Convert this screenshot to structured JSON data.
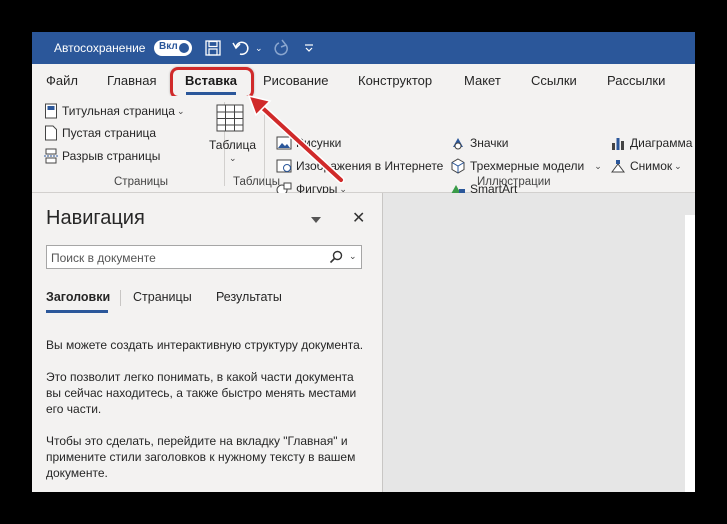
{
  "titlebar": {
    "autosave_label": "Автосохранение",
    "autosave_state": "Вкл"
  },
  "tabs": [
    {
      "label": "Файл"
    },
    {
      "label": "Главная"
    },
    {
      "label": "Вставка",
      "active": true
    },
    {
      "label": "Рисование"
    },
    {
      "label": "Конструктор"
    },
    {
      "label": "Макет"
    },
    {
      "label": "Ссылки"
    },
    {
      "label": "Рассылки"
    }
  ],
  "ribbon": {
    "pages": {
      "items": [
        "Титульная страница",
        "Пустая страница",
        "Разрыв страницы"
      ],
      "group_label": "Страницы"
    },
    "tables": {
      "button_label": "Таблица",
      "group_label": "Таблицы"
    },
    "illustrations": {
      "items": [
        "Рисунки",
        "Изображения в Интернете",
        "Фигуры",
        "Значки",
        "Трехмерные модели",
        "SmartArt",
        "Диаграмма",
        "Снимок"
      ],
      "group_label": "Иллюстрации"
    }
  },
  "navpane": {
    "title": "Навигация",
    "search_placeholder": "Поиск в документе",
    "tabs": [
      "Заголовки",
      "Страницы",
      "Результаты"
    ],
    "paragraphs": [
      "Вы можете создать интерактивную структуру документа.",
      "Это позволит легко понимать, в какой части документа вы сейчас находитесь, а также быстро менять местами его части.",
      "Чтобы это сделать, перейдите на вкладку \"Главная\" и примените стили заголовков к нужному тексту в вашем документе."
    ]
  },
  "colors": {
    "titlebar": "#2b579a",
    "ribbon": "#f3f2f1",
    "highlight": "#d02a2a"
  }
}
